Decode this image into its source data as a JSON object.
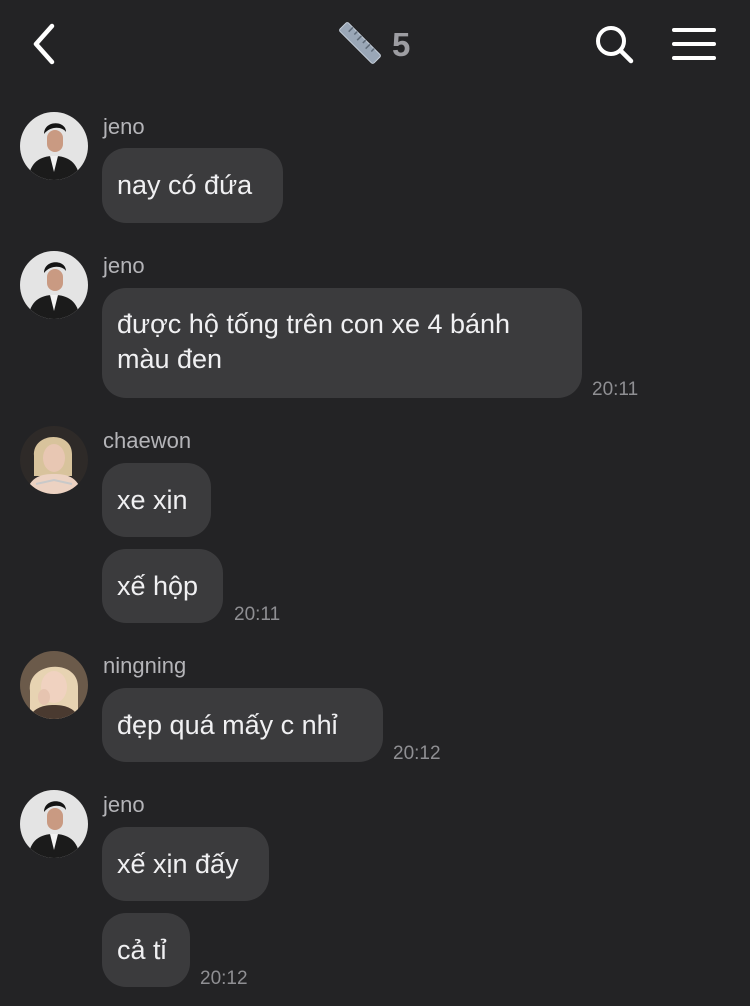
{
  "header": {
    "member_count": "5",
    "icons": {
      "back": "chevron-left-icon",
      "group": "ruler-icon",
      "search": "search-icon",
      "menu": "hamburger-menu-icon"
    }
  },
  "colors": {
    "background": "#232325",
    "bubble": "#3b3b3d",
    "text": "#f0f0f2",
    "secondary_text": "#8f8f93"
  },
  "messages": [
    {
      "sender": "jeno",
      "text": "nay có đứa",
      "time": ""
    },
    {
      "sender": "jeno",
      "text": "được hộ tống trên con xe 4 bánh màu đen",
      "time": "20:11"
    },
    {
      "sender": "chaewon",
      "text": "xe xịn",
      "time": ""
    },
    {
      "sender": "",
      "text": "xế hộp",
      "time": "20:11"
    },
    {
      "sender": "ningning",
      "text": "đẹp quá mấy c nhỉ",
      "time": "20:12"
    },
    {
      "sender": "jeno",
      "text": "xế xịn đấy",
      "time": ""
    },
    {
      "sender": "",
      "text": "cả tỉ",
      "time": "20:12"
    }
  ]
}
